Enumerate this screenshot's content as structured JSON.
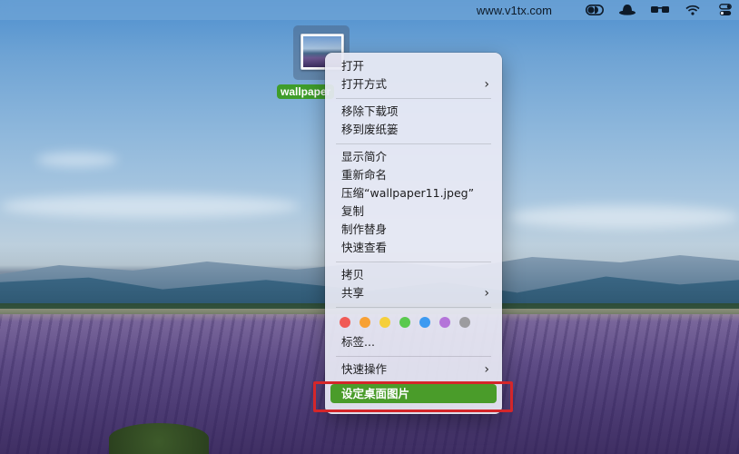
{
  "menubar": {
    "site_text": "www.v1tx.com",
    "icons": [
      "toggle-icon",
      "hat-icon",
      "glasses-icon",
      "wifi-icon",
      "control-center-icon"
    ]
  },
  "desktop_file": {
    "label": "wallpaper"
  },
  "context_menu": {
    "open": "打开",
    "open_with": "打开方式",
    "remove_download": "移除下载项",
    "move_to_trash": "移到废纸篓",
    "get_info": "显示简介",
    "rename": "重新命名",
    "compress": "压缩“wallpaper11.jpeg”",
    "duplicate": "复制",
    "make_alias": "制作替身",
    "quick_look": "快速查看",
    "copy": "拷贝",
    "share": "共享",
    "tag_colors": [
      "#f05a55",
      "#f7a134",
      "#f5cf3b",
      "#5ac94e",
      "#3c9af1",
      "#b474d9",
      "#9c9c9f"
    ],
    "tags": "标签...",
    "quick_actions": "快速操作",
    "set_desktop_picture": "设定桌面图片"
  },
  "colors": {
    "highlight": "#4a9c2a",
    "annotation_box": "#d4262a"
  }
}
